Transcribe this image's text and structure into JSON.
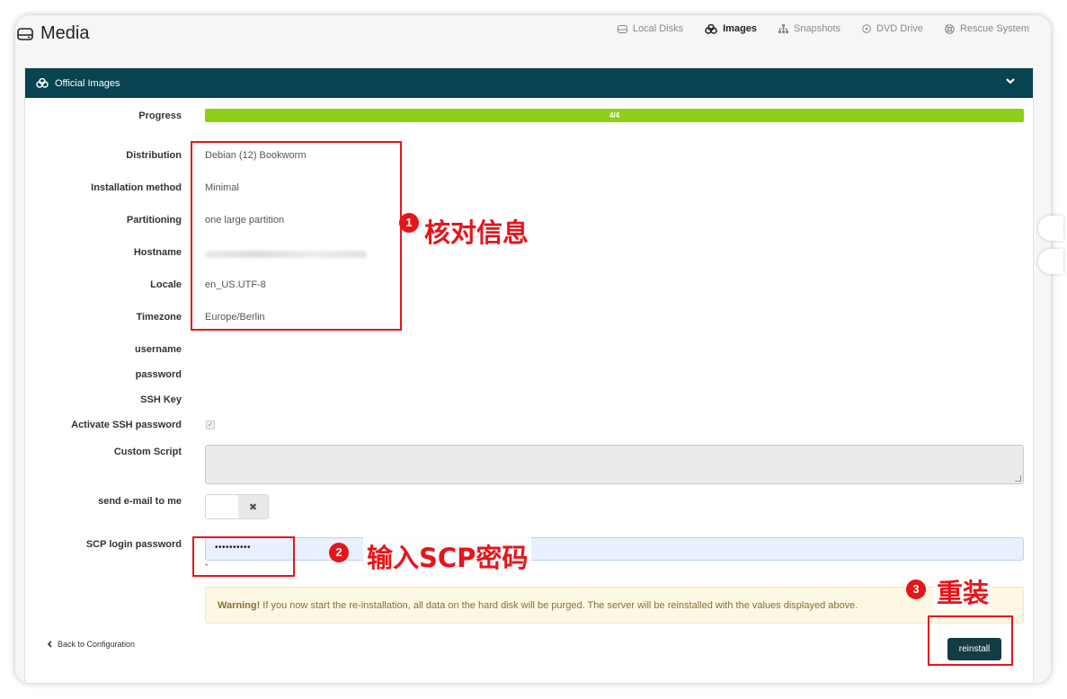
{
  "page": {
    "title": "Media",
    "tabs": [
      {
        "label": "Local Disks",
        "icon": "disk-icon",
        "active": false
      },
      {
        "label": "Images",
        "icon": "images-icon",
        "active": true
      },
      {
        "label": "Snapshots",
        "icon": "sitemap-icon",
        "active": false
      },
      {
        "label": "DVD Drive",
        "icon": "disc-icon",
        "active": false
      },
      {
        "label": "Rescue System",
        "icon": "lifebuoy-icon",
        "active": false
      }
    ]
  },
  "panel": {
    "title": "Official Images",
    "progress": {
      "label": "Progress",
      "text": "4/4",
      "fraction": 1.0,
      "color": "#8fcf17"
    },
    "fields": [
      {
        "label": "Distribution",
        "value": "Debian (12) Bookworm"
      },
      {
        "label": "Installation method",
        "value": "Minimal"
      },
      {
        "label": "Partitioning",
        "value": "one large partition"
      },
      {
        "label": "Hostname",
        "value": ""
      },
      {
        "label": "Locale",
        "value": "en_US.UTF-8"
      },
      {
        "label": "Timezone",
        "value": "Europe/Berlin"
      }
    ],
    "username_label": "username",
    "password_label": "password",
    "ssh_key_label": "SSH Key",
    "activate_ssh_password_label": "Activate SSH password",
    "activate_ssh_password_checked": true,
    "custom_script_label": "Custom Script",
    "custom_script_value": "",
    "send_email_label": "send e-mail to me",
    "send_email_toggle_off_glyph": "✖",
    "scp_password_label": "SCP login password",
    "scp_password_value": "••••••••••",
    "required_mark": "*",
    "warning_strong": "Warning!",
    "warning_text": " If you now start the re-installation, all data on the hard disk will be purged. The server will be reinstalled with the values displayed above.",
    "back_label": "Back to Configuration",
    "reinstall_label": "reinstall"
  },
  "annotations": [
    {
      "number": "1",
      "text": "核对信息"
    },
    {
      "number": "2",
      "text": "输入SCP密码"
    },
    {
      "number": "3",
      "text": "重装"
    }
  ],
  "colors": {
    "header_bg": "#074350",
    "button_bg": "#143c45",
    "annotation_red": "#e8141b",
    "warning_bg": "#fcf8e3"
  }
}
